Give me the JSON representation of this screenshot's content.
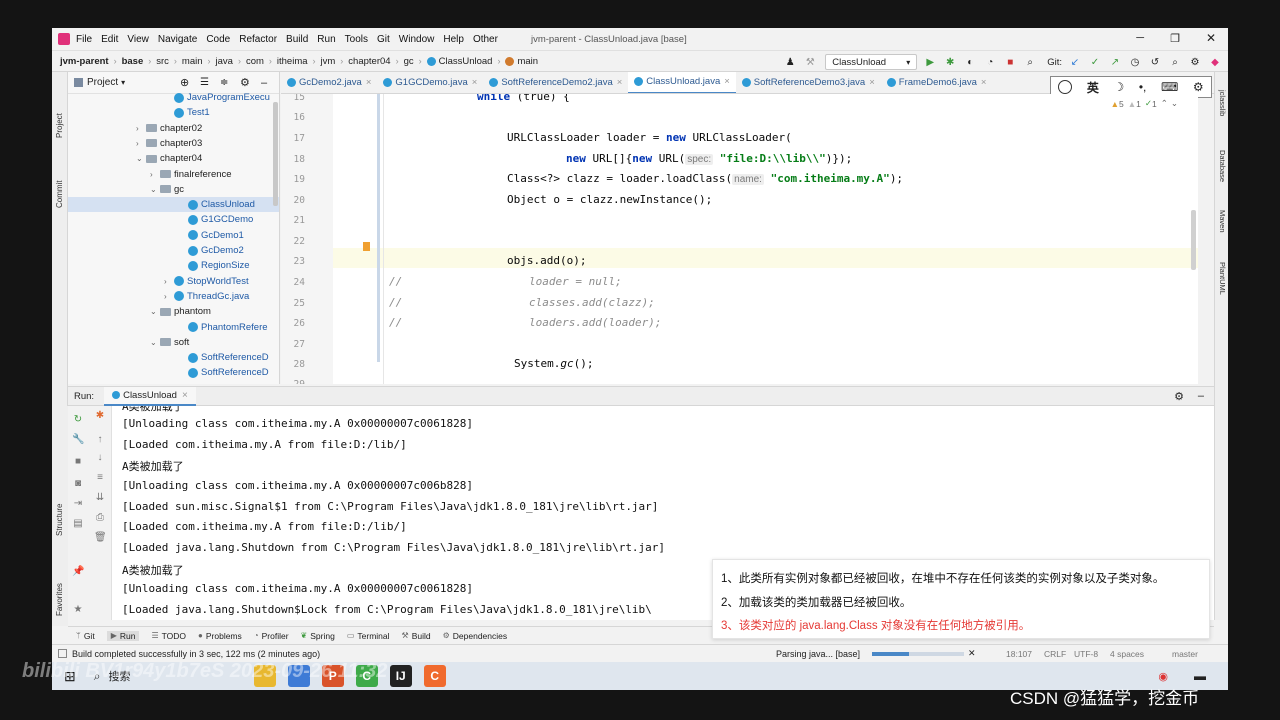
{
  "titlebar": {
    "menu": [
      "File",
      "Edit",
      "View",
      "Navigate",
      "Code",
      "Refactor",
      "Build",
      "Run",
      "Tools",
      "Git",
      "Window",
      "Help",
      "Other"
    ],
    "title": "jvm-parent - ClassUnload.java [base]"
  },
  "navbar": {
    "crumbs": [
      "jvm-parent",
      "base",
      "src",
      "main",
      "java",
      "com",
      "itheima",
      "jvm",
      "chapter04",
      "gc",
      "ClassUnload",
      "main"
    ],
    "run_config": "ClassUnload",
    "git_label": "Git:"
  },
  "left_strip": {
    "project": "Project",
    "commit": "Commit",
    "structure": "Structure",
    "favorites": "Favorites"
  },
  "right_strip": {
    "items": [
      "jclasslib",
      "Database",
      "Maven",
      "PlantUML"
    ]
  },
  "project": {
    "header": "Project",
    "tree": [
      {
        "label": "JavaProgramExecu",
        "kind": "class",
        "arrow": ""
      },
      {
        "label": "Test1",
        "kind": "class",
        "arrow": ""
      },
      {
        "label": "chapter02",
        "kind": "folder",
        "arrow": "›"
      },
      {
        "label": "chapter03",
        "kind": "folder",
        "arrow": "›"
      },
      {
        "label": "chapter04",
        "kind": "folder",
        "arrow": "⌄"
      },
      {
        "label": "finalreference",
        "kind": "folder",
        "arrow": "›"
      },
      {
        "label": "gc",
        "kind": "folder",
        "arrow": "⌄"
      },
      {
        "label": "ClassUnload",
        "kind": "class",
        "arrow": ""
      },
      {
        "label": "G1GCDemo",
        "kind": "class",
        "arrow": ""
      },
      {
        "label": "GcDemo1",
        "kind": "class",
        "arrow": ""
      },
      {
        "label": "GcDemo2",
        "kind": "class",
        "arrow": ""
      },
      {
        "label": "RegionSize",
        "kind": "class",
        "arrow": ""
      },
      {
        "label": "StopWorldTest",
        "kind": "class",
        "arrow": "›"
      },
      {
        "label": "ThreadGc.java",
        "kind": "class",
        "arrow": "›"
      },
      {
        "label": "phantom",
        "kind": "folder",
        "arrow": "⌄"
      },
      {
        "label": "PhantomRefere",
        "kind": "class",
        "arrow": ""
      },
      {
        "label": "soft",
        "kind": "folder",
        "arrow": "⌄"
      },
      {
        "label": "SoftReferenceD",
        "kind": "class",
        "arrow": ""
      },
      {
        "label": "SoftReferenceD",
        "kind": "class",
        "arrow": ""
      }
    ]
  },
  "tabs": [
    "GcDemo2.java",
    "G1GCDemo.java",
    "SoftReferenceDemo2.java",
    "ClassUnload.java",
    "SoftReferenceDemo3.java",
    "FrameDemo6.java"
  ],
  "ime": {
    "chinese": "英"
  },
  "inspections": {
    "warnings": "5",
    "weak": "1",
    "typos": "1"
  },
  "editor": {
    "line_numbers": [
      "15",
      "16",
      "17",
      "18",
      "19",
      "20",
      "21",
      "22",
      "23",
      "24",
      "25",
      "26",
      "27",
      "28",
      "29"
    ],
    "l15_kw": "while",
    "l15_rest": " (true) {",
    "l17_a": "URLClassLoader loader = ",
    "l17_kw": "new",
    "l17_b": " URLClassLoader(",
    "l18_kw1": "new",
    "l18_a": " URL[]{",
    "l18_kw2": "new",
    "l18_b": " URL(",
    "l18_hint": "spec:",
    "l18_str": "\"file:D:\\\\lib\\\\\"",
    "l18_c": ")});",
    "l19_a": "Class<?> clazz = loader.loadClass(",
    "l19_hint": "name:",
    "l19_str": "\"com.itheima.my.A\"",
    "l19_b": ");",
    "l20": "Object o = clazz.newInstance();",
    "l23": "objs.add(o);",
    "l24_mark": "//",
    "l24": "loader = null;",
    "l25_mark": "//",
    "l25": "classes.add(clazz);",
    "l26_mark": "//",
    "l26": "loaders.add(loader);",
    "l28_a": "System.",
    "l28_gc": "gc",
    "l28_b": "();"
  },
  "run": {
    "label": "Run:",
    "config": "ClassUnload"
  },
  "console": {
    "lines": [
      "A类被加载了",
      "[Unloading class com.itheima.my.A 0x00000007c0061828]",
      "[Loaded com.itheima.my.A from file:D:/lib/]",
      "A类被加载了",
      "[Unloading class com.itheima.my.A 0x00000007c006b828]",
      "[Loaded sun.misc.Signal$1 from C:\\Program Files\\Java\\jdk1.8.0_181\\jre\\lib\\rt.jar]",
      "[Loaded com.itheima.my.A from file:D:/lib/]",
      "[Loaded java.lang.Shutdown from C:\\Program Files\\Java\\jdk1.8.0_181\\jre\\lib\\rt.jar]",
      "A类被加载了",
      "[Unloading class com.itheima.my.A 0x00000007c0061828]",
      "[Loaded java.lang.Shutdown$Lock from C:\\Program Files\\Java\\jdk1.8.0_181\\jre\\lib\\"
    ]
  },
  "bottom_tabs": [
    "Git",
    "Run",
    "TODO",
    "Problems",
    "Profiler",
    "Spring",
    "Terminal",
    "Build",
    "Dependencies"
  ],
  "status": {
    "message": "Build completed successfully in 3 sec, 122 ms (2 minutes ago)",
    "parsing": "Parsing java... [base]",
    "position": "18:107",
    "crlf": "CRLF",
    "encoding": "UTF-8",
    "indent": "4 spaces",
    "branch": "master"
  },
  "taskbar": {
    "search": "搜索"
  },
  "annotation": {
    "items": [
      "1、此类所有实例对象都已经被回收，在堆中不存在任何该类的实例对象以及子类对象。",
      "2、加载该类的类加载器已经被回收。",
      "3、该类对应的 java.lang.Class 对象没有在任何地方被引用。"
    ],
    "highlight_color": "#e53935"
  },
  "overlay": {
    "bilibili_id": "bilibili BV1r94y1b7eS 2023-09-26 11:32",
    "csdn": "CSDN @猛猛学，挖金币"
  }
}
